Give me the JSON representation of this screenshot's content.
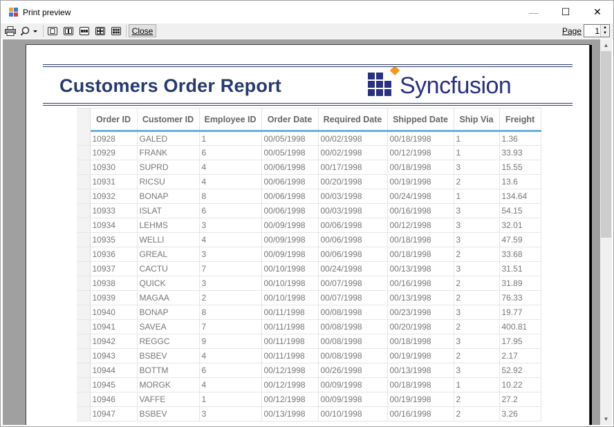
{
  "window": {
    "title": "Print preview",
    "min_symbol": "—",
    "max_symbol": "☐",
    "close_symbol": "✕"
  },
  "toolbar": {
    "print_icon": "printer-icon",
    "zoom_icon": "magnifier-icon",
    "layout_icons": [
      "one-page-icon",
      "two-pages-icon",
      "three-pages-icon",
      "four-pages-icon",
      "six-pages-icon"
    ],
    "close_label": "Close",
    "page_label": "Page",
    "page_value": "1"
  },
  "report": {
    "title": "Customers Order Report",
    "logo_text": "Syncfusion",
    "accent_color": "#273a6e",
    "logo_orange": "#f7941d",
    "header_underline_color": "#6ab0db",
    "columns": [
      "Order ID",
      "Customer ID",
      "Employee ID",
      "Order Date",
      "Required Date",
      "Shipped Date",
      "Ship Via",
      "Freight"
    ],
    "rows": [
      [
        "10928",
        "GALED",
        "1",
        "00/05/1998",
        "00/02/1998",
        "00/18/1998",
        "1",
        "1.36"
      ],
      [
        "10929",
        "FRANK",
        "6",
        "00/05/1998",
        "00/02/1998",
        "00/12/1998",
        "1",
        "33.93"
      ],
      [
        "10930",
        "SUPRD",
        "4",
        "00/06/1998",
        "00/17/1998",
        "00/18/1998",
        "3",
        "15.55"
      ],
      [
        "10931",
        "RICSU",
        "4",
        "00/06/1998",
        "00/20/1998",
        "00/19/1998",
        "2",
        "13.6"
      ],
      [
        "10932",
        "BONAP",
        "8",
        "00/06/1998",
        "00/03/1998",
        "00/24/1998",
        "1",
        "134.64"
      ],
      [
        "10933",
        "ISLAT",
        "6",
        "00/06/1998",
        "00/03/1998",
        "00/16/1998",
        "3",
        "54.15"
      ],
      [
        "10934",
        "LEHMS",
        "3",
        "00/09/1998",
        "00/06/1998",
        "00/12/1998",
        "3",
        "32.01"
      ],
      [
        "10935",
        "WELLI",
        "4",
        "00/09/1998",
        "00/06/1998",
        "00/18/1998",
        "3",
        "47.59"
      ],
      [
        "10936",
        "GREAL",
        "3",
        "00/09/1998",
        "00/06/1998",
        "00/18/1998",
        "2",
        "33.68"
      ],
      [
        "10937",
        "CACTU",
        "7",
        "00/10/1998",
        "00/24/1998",
        "00/13/1998",
        "3",
        "31.51"
      ],
      [
        "10938",
        "QUICK",
        "3",
        "00/10/1998",
        "00/07/1998",
        "00/16/1998",
        "2",
        "31.89"
      ],
      [
        "10939",
        "MAGAA",
        "2",
        "00/10/1998",
        "00/07/1998",
        "00/13/1998",
        "2",
        "76.33"
      ],
      [
        "10940",
        "BONAP",
        "8",
        "00/11/1998",
        "00/08/1998",
        "00/23/1998",
        "3",
        "19.77"
      ],
      [
        "10941",
        "SAVEA",
        "7",
        "00/11/1998",
        "00/08/1998",
        "00/20/1998",
        "2",
        "400.81"
      ],
      [
        "10942",
        "REGGC",
        "9",
        "00/11/1998",
        "00/08/1998",
        "00/18/1998",
        "3",
        "17.95"
      ],
      [
        "10943",
        "BSBEV",
        "4",
        "00/11/1998",
        "00/08/1998",
        "00/19/1998",
        "2",
        "2.17"
      ],
      [
        "10944",
        "BOTTM",
        "6",
        "00/12/1998",
        "00/26/1998",
        "00/13/1998",
        "3",
        "52.92"
      ],
      [
        "10945",
        "MORGK",
        "4",
        "00/12/1998",
        "00/09/1998",
        "00/18/1998",
        "1",
        "10.22"
      ],
      [
        "10946",
        "VAFFE",
        "1",
        "00/12/1998",
        "00/09/1998",
        "00/19/1998",
        "2",
        "27.2"
      ],
      [
        "10947",
        "BSBEV",
        "3",
        "00/13/1998",
        "00/10/1998",
        "00/16/1998",
        "2",
        "3.26"
      ]
    ]
  },
  "scrollbar": {
    "up_icon": "scroll-up-arrow-icon",
    "down_icon": "scroll-down-arrow-icon"
  }
}
